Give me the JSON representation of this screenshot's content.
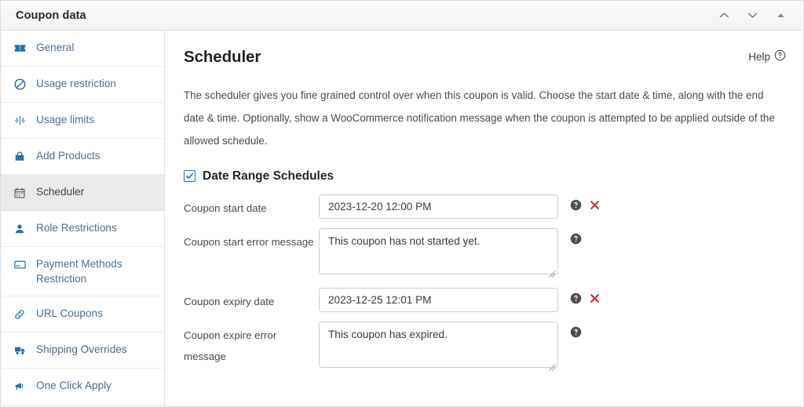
{
  "window": {
    "title": "Coupon data",
    "controls": [
      {
        "name": "move-up-button",
        "icon": "chevron-up-icon"
      },
      {
        "name": "move-down-button",
        "icon": "chevron-down-icon"
      },
      {
        "name": "collapse-panel-toggle",
        "icon": "triangle-up-icon"
      }
    ]
  },
  "sidebar": {
    "items": [
      {
        "label": "General",
        "icon": "ticket-icon",
        "active": false
      },
      {
        "label": "Usage restriction",
        "icon": "no-entry-icon",
        "active": false
      },
      {
        "label": "Usage limits",
        "icon": "usage-limits-icon",
        "active": false
      },
      {
        "label": "Add Products",
        "icon": "products-bag-icon",
        "active": false
      },
      {
        "label": "Scheduler",
        "icon": "calendar-icon",
        "active": true
      },
      {
        "label": "Role Restrictions",
        "icon": "user-icon",
        "active": false
      },
      {
        "label": "Payment Methods Restriction",
        "icon": "credit-card-icon",
        "active": false
      },
      {
        "label": "URL Coupons",
        "icon": "link-icon",
        "active": false
      },
      {
        "label": "Shipping Overrides",
        "icon": "shipping-truck-icon",
        "active": false
      },
      {
        "label": "One Click Apply",
        "icon": "megaphone-icon",
        "active": false
      }
    ]
  },
  "main": {
    "title": "Scheduler",
    "help_label": "Help",
    "description": "The scheduler gives you fine grained control over when this coupon is valid. Choose the start date & time, along with the end date & time. Optionally, show a WooCommerce notification message when the coupon is attempted to be applied outside of the allowed schedule.",
    "section": {
      "label": "Date Range Schedules",
      "checked": true
    },
    "fields": [
      {
        "label": "Coupon start date",
        "type": "text",
        "value": "2023-12-20 12:00 PM",
        "placeholder": "",
        "has_help": true,
        "has_clear": true
      },
      {
        "label": "Coupon start error message",
        "type": "textarea",
        "value": "This coupon has not started yet.",
        "placeholder": "",
        "has_help": true,
        "has_clear": false
      },
      {
        "label": "Coupon expiry date",
        "type": "text",
        "value": "2023-12-25 12:01 PM",
        "placeholder": "",
        "has_help": true,
        "has_clear": true
      },
      {
        "label": "Coupon expire error message",
        "type": "textarea",
        "value": "This coupon has expired.",
        "placeholder": "",
        "has_help": true,
        "has_clear": false
      }
    ]
  },
  "colors": {
    "link_blue": "#2271b1",
    "nav_text": "#4b6f92",
    "active_bg": "#eaeaea",
    "help_icon": "#4c4c4c",
    "clear_red": "#d63638",
    "border": "#cfcfcf"
  }
}
